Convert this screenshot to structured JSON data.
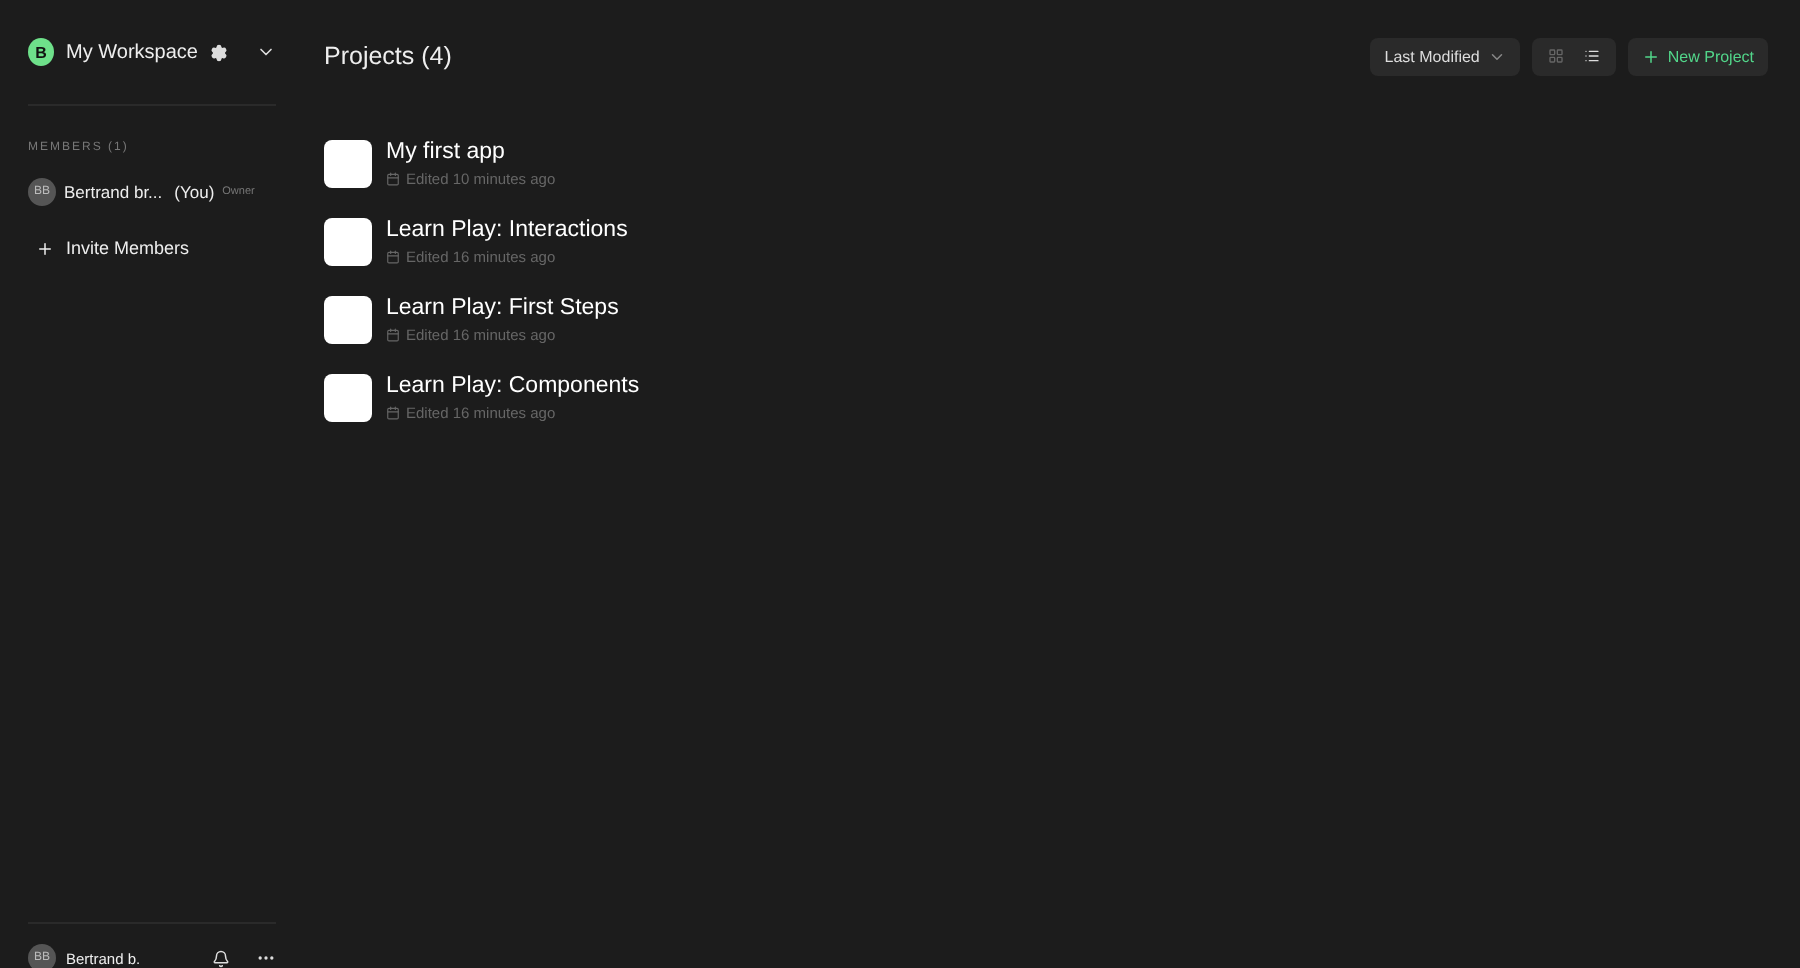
{
  "workspace": {
    "initial": "B",
    "name": "My Workspace"
  },
  "members": {
    "heading": "MEMBERS (1)",
    "items": [
      {
        "initials": "BB",
        "name": "Bertrand br...",
        "you": "(You)",
        "role": "Owner"
      }
    ]
  },
  "invite": {
    "label": "Invite Members"
  },
  "header": {
    "title": "Projects (4)",
    "sort": "Last Modified",
    "views": [
      {
        "kind": "grid",
        "selected": false
      },
      {
        "kind": "list",
        "selected": true
      }
    ],
    "new_button": "New Project"
  },
  "projects": [
    {
      "name": "My first app",
      "edited": "Edited 10 minutes ago"
    },
    {
      "name": "Learn Play: Interactions",
      "edited": "Edited 16 minutes ago"
    },
    {
      "name": "Learn Play: First Steps",
      "edited": "Edited 16 minutes ago"
    },
    {
      "name": "Learn Play: Components",
      "edited": "Edited 16 minutes ago"
    }
  ],
  "footer_user": {
    "initials": "BB",
    "name": "Bertrand b."
  }
}
